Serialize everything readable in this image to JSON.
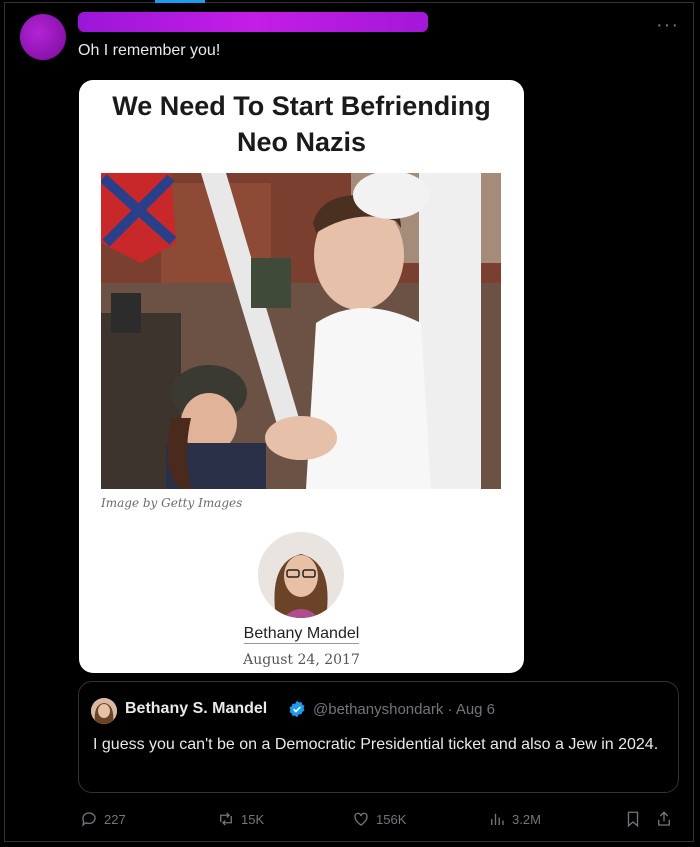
{
  "tweet": {
    "text": "Oh I remember you!",
    "more_icon": "more-horizontal-icon"
  },
  "card": {
    "headline_line1": "We Need To Start Befriending",
    "headline_line2": "Neo Nazis",
    "image_credit": "Image by Getty Images",
    "author_name": "Bethany Mandel",
    "date": "August 24, 2017"
  },
  "quote": {
    "name": "Bethany S. Mandel",
    "handle_and_time": "@bethanyshondark · Aug 6",
    "text": "I guess you can't be on a Democratic Presidential ticket and also a Jew in 2024."
  },
  "actions": {
    "replies": "227",
    "reposts": "15K",
    "likes": "156K",
    "views": "3.2M"
  },
  "colors": {
    "background": "#000000",
    "accent": "#1d9bf0",
    "muted_text": "#71767b",
    "redaction": "#b31ee0"
  }
}
